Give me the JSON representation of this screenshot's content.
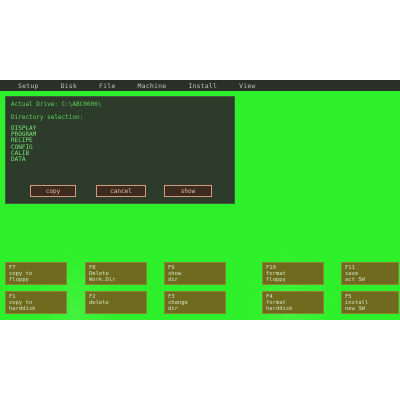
{
  "menu": [
    "Setup",
    "Disk",
    "File",
    "Machine",
    "Install",
    "View"
  ],
  "dialog": {
    "title": "Actual Drive: C:\\ABC0006\\",
    "subtitle": "Directory selection:",
    "directories": [
      "DISPLAY",
      "PROGRAM",
      "RECIPE",
      "CONFIG",
      "CALIB",
      "DATA"
    ],
    "buttons": {
      "copy": "copy",
      "cancel": "cancel",
      "show": "show"
    }
  },
  "fkeys_top": [
    {
      "key": "F7",
      "line1": "copy to",
      "line2": "floppy"
    },
    {
      "key": "F8",
      "line1": "Delete",
      "line2": "Work.Dir"
    },
    {
      "key": "F9",
      "line1": "show",
      "line2": "dir"
    },
    {
      "key": "F10",
      "line1": "format",
      "line2": "floppy"
    },
    {
      "key": "F11",
      "line1": "save",
      "line2": "act SW"
    }
  ],
  "fkeys_bottom": [
    {
      "key": "F1",
      "line1": "copy to",
      "line2": "harddisk"
    },
    {
      "key": "F2",
      "line1": "delete",
      "line2": ""
    },
    {
      "key": "F3",
      "line1": "change",
      "line2": "dir"
    },
    {
      "key": "F4",
      "line1": "format",
      "line2": "harddisk"
    },
    {
      "key": "F5",
      "line1": "install",
      "line2": "new SW"
    }
  ],
  "colors": {
    "screen": "#2ef02a",
    "menubar": "#2a2f28",
    "dialog": "#2c3b2a",
    "fkey": "#6f6a1e",
    "button_border": "#d39a7a"
  }
}
